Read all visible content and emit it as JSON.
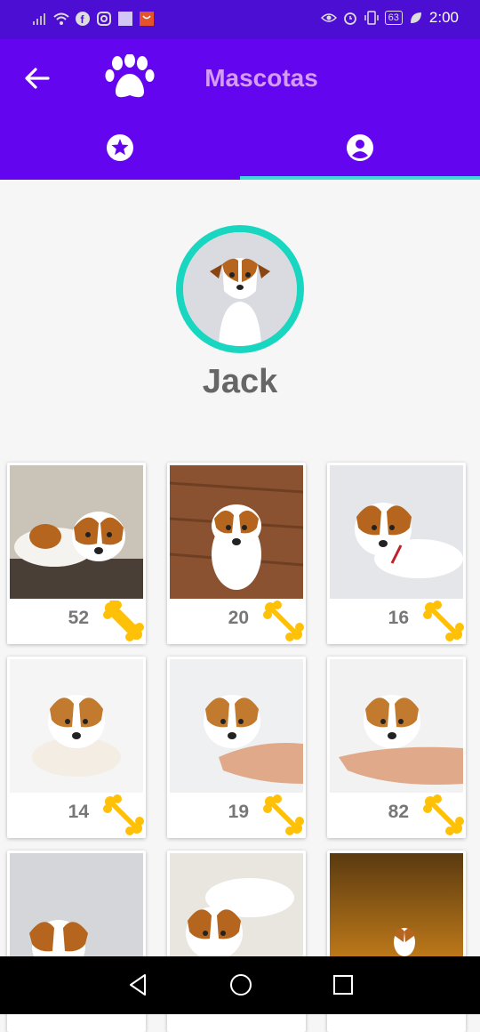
{
  "status_bar": {
    "time": "2:00",
    "battery": "63"
  },
  "app_bar": {
    "title": "Mascotas"
  },
  "tabs": [
    {
      "name": "favorites-tab",
      "icon": "star-circle-icon"
    },
    {
      "name": "profile-tab",
      "icon": "account-circle-icon",
      "selected": true
    }
  ],
  "profile": {
    "name": "Jack"
  },
  "photos": [
    {
      "likes": "52"
    },
    {
      "likes": "20"
    },
    {
      "likes": "16"
    },
    {
      "likes": "14"
    },
    {
      "likes": "19"
    },
    {
      "likes": "82"
    },
    {
      "likes": ""
    },
    {
      "likes": ""
    },
    {
      "likes": ""
    }
  ],
  "colors": {
    "primary": "#6405f0",
    "status_bar": "#4c0ed2",
    "accent": "#3fd9dd",
    "title": "#d49cf5",
    "bone": "#ffc107"
  }
}
